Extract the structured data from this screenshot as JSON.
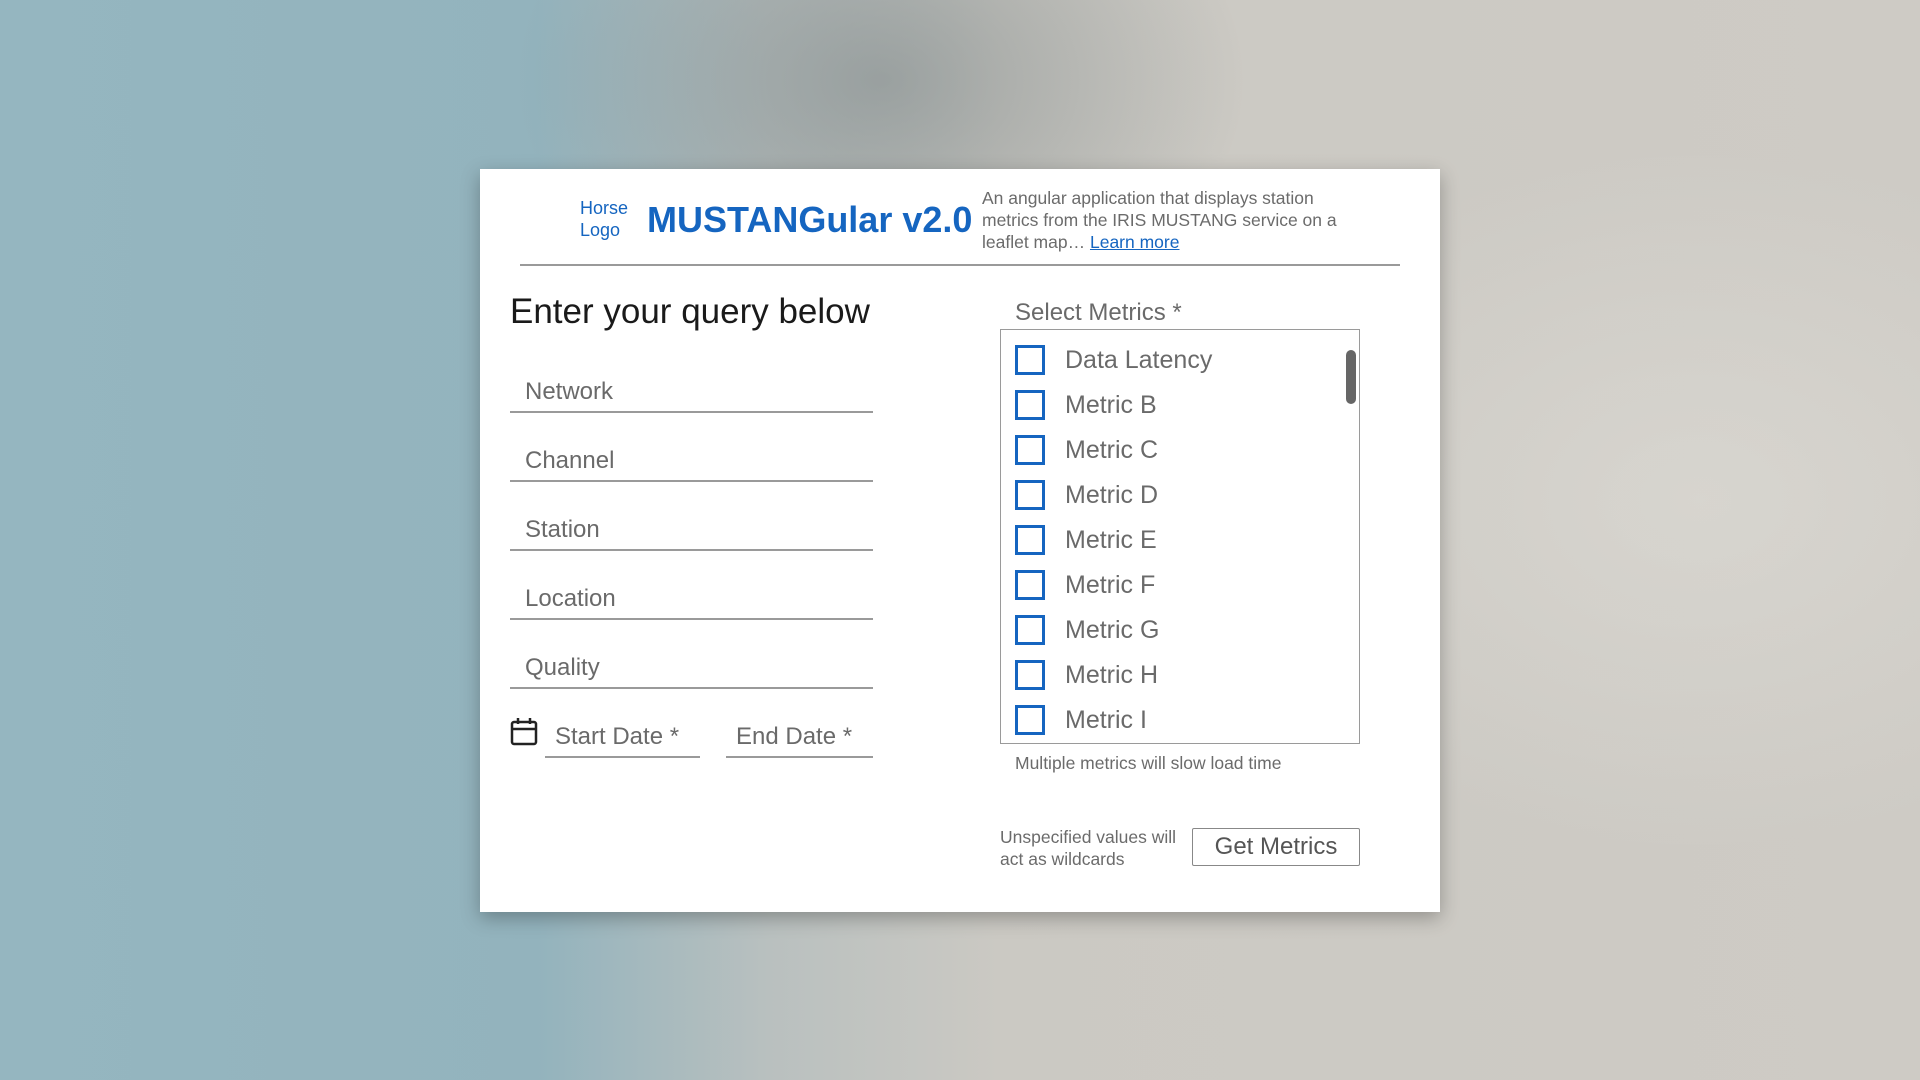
{
  "header": {
    "logo_text": "Horse Logo",
    "title": "MUSTANGular v2.0",
    "description": "An angular application that displays station metrics from the IRIS MUSTANG service on a leaflet map…",
    "learn_more": "Learn more"
  },
  "query": {
    "heading": "Enter your query below",
    "fields": {
      "network": "Network",
      "channel": "Channel",
      "station": "Station",
      "location": "Location",
      "quality": "Quality"
    },
    "start_date": "Start Date *",
    "end_date": "End Date *"
  },
  "metrics": {
    "label": "Select Metrics *",
    "items": [
      {
        "label": "Data Latency",
        "checked": false
      },
      {
        "label": "Metric B",
        "checked": false
      },
      {
        "label": "Metric C",
        "checked": false
      },
      {
        "label": "Metric D",
        "checked": false
      },
      {
        "label": "Metric E",
        "checked": false
      },
      {
        "label": "Metric F",
        "checked": false
      },
      {
        "label": "Metric G",
        "checked": false
      },
      {
        "label": "Metric H",
        "checked": false
      },
      {
        "label": "Metric I",
        "checked": false
      }
    ],
    "hint": "Multiple metrics will slow load time"
  },
  "footer": {
    "wildcard_note": "Unspecified values will act as wildcards",
    "submit_label": "Get Metrics"
  },
  "colors": {
    "accent": "#1565c0",
    "muted_text": "#6a6a6a",
    "divider": "#9a9a9a"
  }
}
